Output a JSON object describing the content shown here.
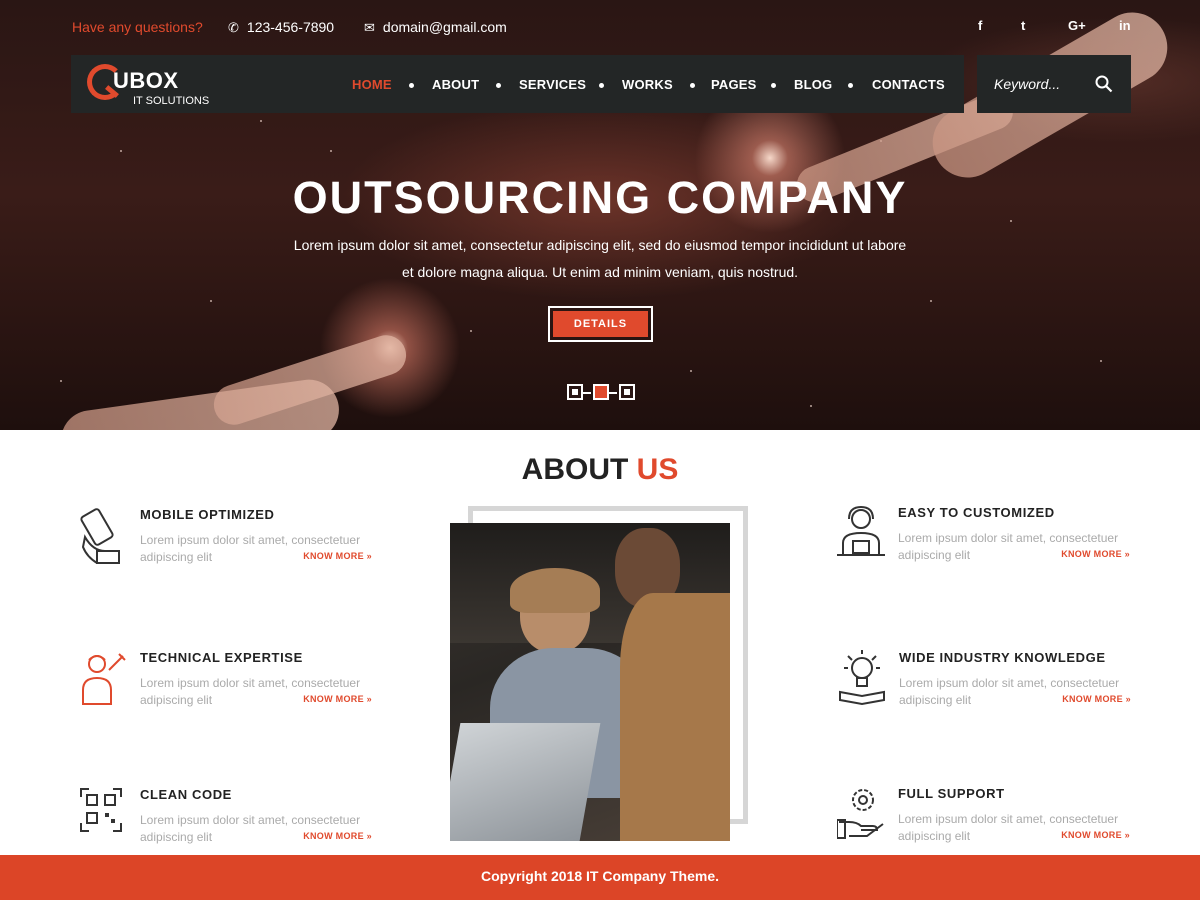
{
  "topbar": {
    "question": "Have any questions?",
    "phone": "123-456-7890",
    "email": "domain@gmail.com",
    "social": {
      "facebook": "f",
      "twitter": "t",
      "google_plus": "G+",
      "linkedin": "in"
    }
  },
  "logo": {
    "name": "UBOX",
    "subtitle": "IT SOLUTIONS"
  },
  "nav": {
    "home": "HOME",
    "about": "ABOUT",
    "services": "SERVICES",
    "works": "WORKS",
    "pages": "PAGES",
    "blog": "BLOG",
    "contacts": "CONTACTS"
  },
  "search": {
    "placeholder": "Keyword..."
  },
  "hero": {
    "title": "OUTSOURCING COMPANY",
    "text": "Lorem ipsum dolor sit amet, consectetur adipiscing elit, sed do eiusmod tempor incididunt ut labore et dolore magna aliqua. Ut enim ad minim veniam, quis nostrud.",
    "button": "DETAILS",
    "active_slide": 2
  },
  "about": {
    "title_main": "ABOUT ",
    "title_accent": "US",
    "features": [
      {
        "title": "MOBILE OPTIMIZED",
        "text": "Lorem ipsum dolor sit amet, consectetuer adipiscing elit",
        "more": "KNOW MORE »",
        "icon": "mobile-hand-icon"
      },
      {
        "title": "TECHNICAL EXPERTISE",
        "text": "Lorem ipsum dolor sit amet, consectetuer adipiscing elit",
        "more": "KNOW MORE »",
        "icon": "technician-icon"
      },
      {
        "title": "CLEAN CODE",
        "text": "Lorem ipsum dolor sit amet, consectetuer adipiscing elit",
        "more": "KNOW MORE »",
        "icon": "qr-code-icon"
      },
      {
        "title": "EASY TO CUSTOMIZED",
        "text": "Lorem ipsum dolor sit amet, consectetuer adipiscing elit",
        "more": "KNOW MORE »",
        "icon": "support-agent-icon"
      },
      {
        "title": "WIDE INDUSTRY KNOWLEDGE",
        "text": "Lorem ipsum dolor sit amet, consectetuer adipiscing elit",
        "more": "KNOW MORE »",
        "icon": "lightbulb-book-icon"
      },
      {
        "title": "FULL SUPPORT",
        "text": "Lorem ipsum dolor sit amet, consectetuer adipiscing elit",
        "more": "KNOW MORE »",
        "icon": "gear-hand-icon"
      }
    ]
  },
  "footer": {
    "copyright": "Copyright 2018 IT Company Theme."
  },
  "colors": {
    "accent": "#e04a2d",
    "nav_bg": "#232626",
    "footer_bg": "#dc4527"
  }
}
